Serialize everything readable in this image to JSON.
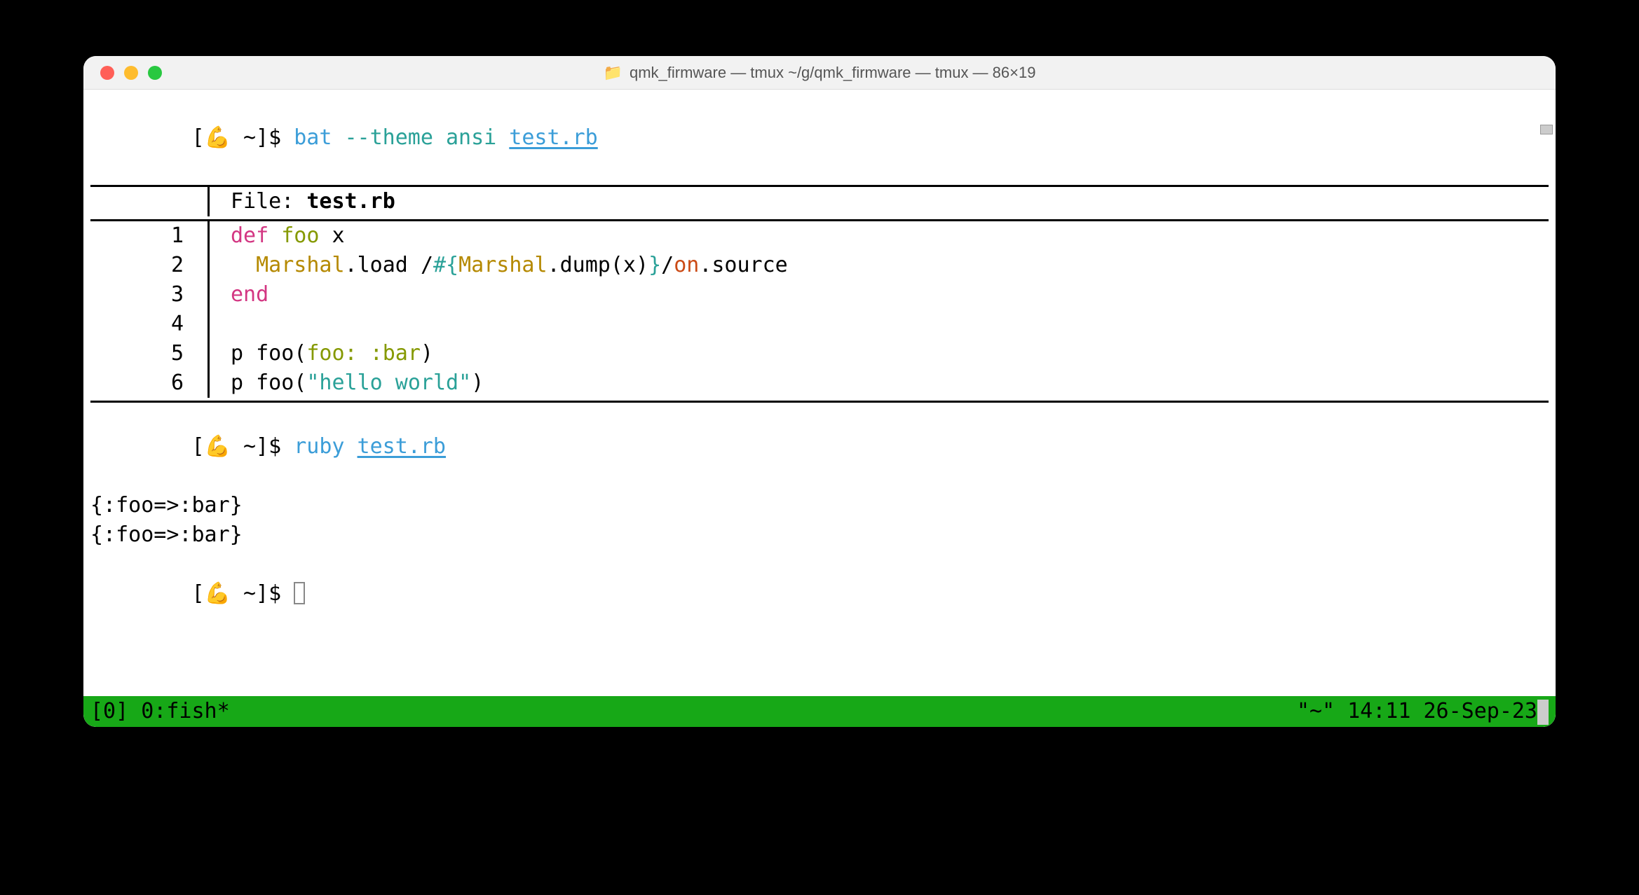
{
  "window": {
    "title": "qmk_firmware — tmux ~/g/qmk_firmware — tmux — 86×19"
  },
  "prompt1": {
    "open": "[",
    "emoji": "💪",
    "path": " ~",
    "close": "]$ ",
    "cmd": "bat",
    "flag": " --theme ",
    "arg1": "ansi ",
    "file": "test.rb"
  },
  "bat": {
    "file_label": "File: ",
    "file_name": "test.rb",
    "lines": {
      "l1_num": "1",
      "l1_def": "def",
      "l1_space": " ",
      "l1_foo": "foo",
      "l1_x": " x",
      "l2_num": "2",
      "l2_indent": "  ",
      "l2_marshal": "Marshal",
      "l2_dotload": ".load ",
      "l2_slash1": "/",
      "l2_interp_open": "#{",
      "l2_marshal2": "Marshal",
      "l2_dump": ".dump(x)",
      "l2_interp_close": "}",
      "l2_slash2": "/",
      "l2_on": "on",
      "l2_source": ".source",
      "l3_num": "3",
      "l3_end": "end",
      "l4_num": "4",
      "l4_blank": "",
      "l5_num": "5",
      "l5_p": "p foo(",
      "l5_key": "foo:",
      "l5_space": " ",
      "l5_sym": ":bar",
      "l5_close": ")",
      "l6_num": "6",
      "l6_p": "p foo(",
      "l6_str": "\"hello world\"",
      "l6_close": ")"
    }
  },
  "prompt2": {
    "open": "[",
    "emoji": "💪",
    "path": " ~",
    "close": "]$ ",
    "cmd": "ruby ",
    "file": "test.rb"
  },
  "output": {
    "line1": "{:foo=>:bar}",
    "line2": "{:foo=>:bar}"
  },
  "prompt3": {
    "open": "[",
    "emoji": "💪",
    "path": " ~",
    "close": "]$ "
  },
  "tmux": {
    "left": "[0] 0:fish*",
    "right": "\"~\"  14:11 26-Sep-23"
  }
}
